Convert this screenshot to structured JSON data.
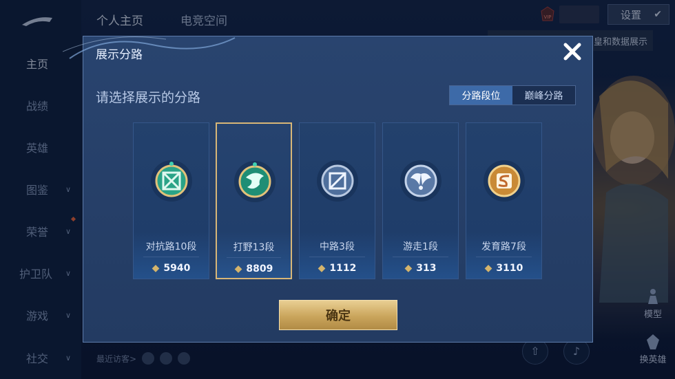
{
  "top_tabs": [
    "个人主页",
    "电竞空间"
  ],
  "sidebar": {
    "items": [
      {
        "label": "主页",
        "chevron": false
      },
      {
        "label": "战绩",
        "chevron": false
      },
      {
        "label": "英雄",
        "chevron": false
      },
      {
        "label": "图鉴",
        "chevron": true
      },
      {
        "label": "荣誉",
        "chevron": true
      },
      {
        "label": "护卫队",
        "chevron": true
      },
      {
        "label": "游戏",
        "chevron": true
      },
      {
        "label": "社交",
        "chevron": true
      }
    ]
  },
  "header": {
    "vip_label": "VIP",
    "settings_label": "设置",
    "bubble_text": "皇和数据展示"
  },
  "right_panel": {
    "model_label": "模型",
    "switch_hero_label": "换英雄"
  },
  "bottom": {
    "recent_visitors": "最近访客>"
  },
  "modal": {
    "title": "展示分路",
    "subtitle": "请选择展示的分路",
    "tabs": [
      "分路段位",
      "巅峰分路"
    ],
    "active_tab": 0,
    "confirm_label": "确定",
    "lanes": [
      {
        "name": "对抗路10段",
        "score": "5940",
        "icon": "clash-lane-emblem-icon",
        "color": "#39c7a5"
      },
      {
        "name": "打野13段",
        "score": "8809",
        "icon": "jungle-dragon-emblem-icon",
        "color": "#2fb08f",
        "selected": true
      },
      {
        "name": "中路3段",
        "score": "1112",
        "icon": "mid-lane-emblem-icon",
        "color": "#7f95b8"
      },
      {
        "name": "游走1段",
        "score": "313",
        "icon": "roam-wings-emblem-icon",
        "color": "#8aa3c6"
      },
      {
        "name": "发育路7段",
        "score": "3110",
        "icon": "farm-lane-emblem-icon",
        "color": "#d4913a"
      }
    ]
  },
  "colors": {
    "gold": "#d9b777",
    "modal_bg": "#29446f",
    "accent_blue": "#3d6aa8"
  }
}
